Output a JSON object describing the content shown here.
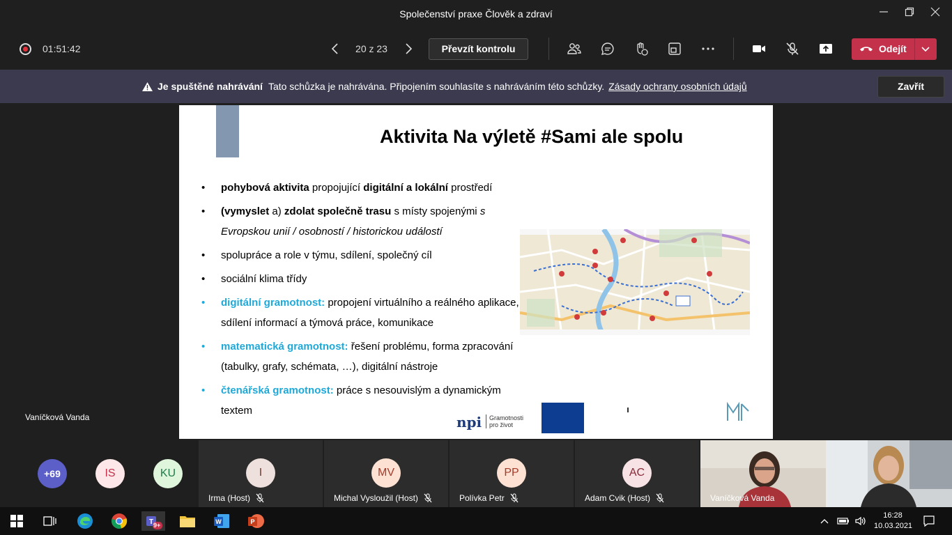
{
  "window": {
    "title": "Společenství praxe Člověk a zdraví"
  },
  "toolbar": {
    "timer": "01:51:42",
    "pager": "20 z 23",
    "take_control": "Převzít kontrolu",
    "leave": "Odejít"
  },
  "banner": {
    "bold": "Je spuštěné nahrávání",
    "text": "Tato schůzka je nahrávána. Připojením souhlasíte s nahráváním této schůzky.",
    "link": "Zásady ochrany osobních údajů",
    "close": "Zavřít"
  },
  "stage": {
    "presenter": "Vaníčková Vanda"
  },
  "slide": {
    "title": "Aktivita Na výletě #Sami ale spolu",
    "b1": {
      "s1": "pohybová aktivita",
      "t1": " propojující ",
      "s2": "digitální a lokální",
      "t2": " prostředí"
    },
    "b2": {
      "t0": "(",
      "s1": "vymyslet",
      "t1": " a) ",
      "s2": "zdolat společně trasu",
      "t2": " s místy spojenými ",
      "i1": "s Evropskou unií / osobností / historickou událostí"
    },
    "b3": "spolupráce a role v týmu, sdílení, společný cíl",
    "b4": "sociální klima třídy",
    "b5": {
      "hl": "digitální gramotnost:",
      "t": " propojení virtuálního a reálného aplikace, sdílení informací a týmová práce, komunikace"
    },
    "b6": {
      "hl": "matematická gramotnost:",
      "t": " řešení problému, forma zpracování (tabulky, grafy, schémata, …), digitální nástroje"
    },
    "b7": {
      "hl": "čtenářská gramotnost:",
      "t": " práce s nesouvislým a dynamickým textem"
    },
    "logo_npi": "npi",
    "logo_npi_sub1": "Gramotnosti",
    "logo_npi_sub2": "pro život"
  },
  "participants": {
    "more": "+69",
    "a1": "IS",
    "a2": "KU",
    "tiles": [
      {
        "initials": "I",
        "name": "Irma (Host)"
      },
      {
        "initials": "MV",
        "name": "Michal Vysloužil (Host)"
      },
      {
        "initials": "PP",
        "name": "Polívka Petr"
      },
      {
        "initials": "AC",
        "name": "Adam Cvik (Host)"
      }
    ],
    "video1": "Vaníčková Vanda"
  },
  "taskbar": {
    "teams_badge": "9+",
    "time": "16:28",
    "date": "10.03.2021"
  },
  "colors": {
    "leave": "#c4314b",
    "banner": "#3b3a4f",
    "accent_blue": "#1ea9d8",
    "slide_bar": "#8497b0"
  }
}
